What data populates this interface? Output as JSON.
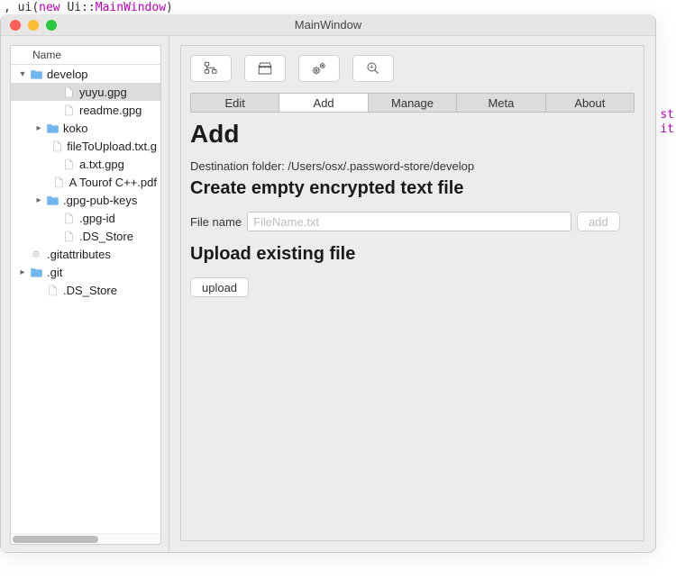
{
  "code_top": {
    "t1": ", ",
    "t2": "ui",
    "t3": "(",
    "t4": "new",
    "t5": " Ui::",
    "t6": "MainWindow",
    "t7": ")"
  },
  "edge": {
    "l1": "st",
    "l2": "it"
  },
  "window": {
    "title": "MainWindow"
  },
  "tree": {
    "header": "Name",
    "items": [
      {
        "depth": 0,
        "chev": "down",
        "icon": "folder",
        "label": "develop",
        "selected": false
      },
      {
        "depth": 2,
        "chev": "",
        "icon": "file",
        "label": "yuyu.gpg",
        "selected": true
      },
      {
        "depth": 2,
        "chev": "",
        "icon": "file",
        "label": "readme.gpg",
        "selected": false
      },
      {
        "depth": 1,
        "chev": "right",
        "icon": "folder",
        "label": "koko",
        "selected": false
      },
      {
        "depth": 2,
        "chev": "",
        "icon": "file",
        "label": "fileToUpload.txt.g",
        "selected": false
      },
      {
        "depth": 2,
        "chev": "",
        "icon": "file",
        "label": "a.txt.gpg",
        "selected": false
      },
      {
        "depth": 2,
        "chev": "",
        "icon": "file",
        "label": "A Tourof C++.pdf",
        "selected": false
      },
      {
        "depth": 1,
        "chev": "right",
        "icon": "folder",
        "label": ".gpg-pub-keys",
        "selected": false
      },
      {
        "depth": 2,
        "chev": "",
        "icon": "file",
        "label": ".gpg-id",
        "selected": false
      },
      {
        "depth": 2,
        "chev": "",
        "icon": "file",
        "label": ".DS_Store",
        "selected": false
      },
      {
        "depth": 0,
        "chev": "",
        "icon": "gear",
        "label": ".gitattributes",
        "selected": false
      },
      {
        "depth": 0,
        "chev": "right",
        "icon": "folder",
        "label": ".git",
        "selected": false
      },
      {
        "depth": 1,
        "chev": "",
        "icon": "file",
        "label": ".DS_Store",
        "selected": false
      }
    ]
  },
  "toolbar_icons": [
    "tree-icon",
    "store-icon",
    "gears-icon",
    "zoom-icon"
  ],
  "tabs": [
    {
      "label": "Edit",
      "active": false
    },
    {
      "label": "Add",
      "active": true
    },
    {
      "label": "Manage",
      "active": false
    },
    {
      "label": "Meta",
      "active": false
    },
    {
      "label": "About",
      "active": false
    }
  ],
  "page": {
    "title": "Add",
    "destination_label": "Destination folder: ",
    "destination_path": "/Users/osx/.password-store/develop",
    "section_create": "Create empty encrypted text file",
    "filename_label": "File name",
    "filename_placeholder": "FileName.txt",
    "add_button": "add",
    "section_upload": "Upload existing file",
    "upload_button": "upload"
  }
}
